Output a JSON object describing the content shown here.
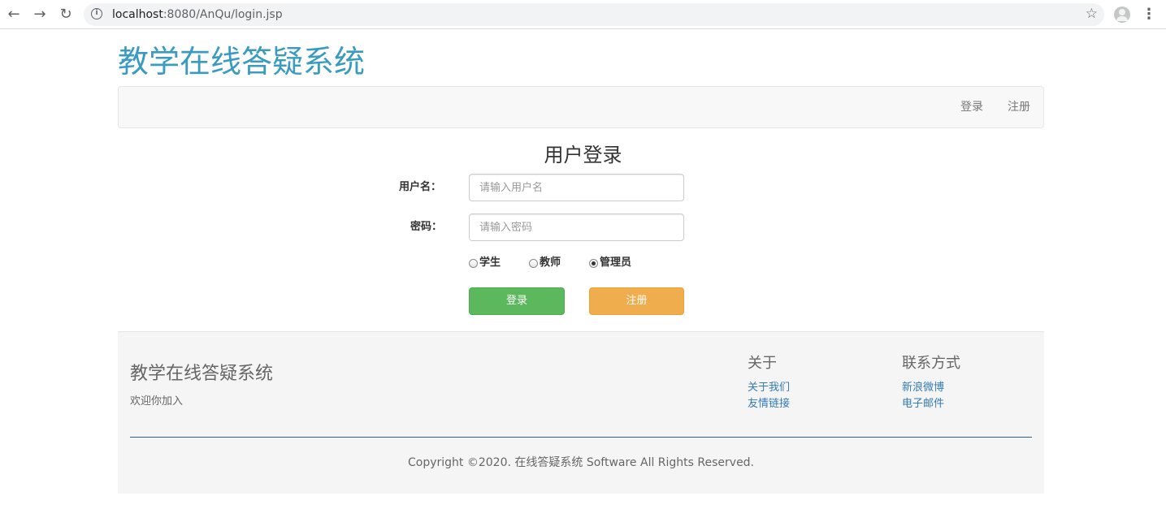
{
  "browser": {
    "url_host": "localhost",
    "url_rest": ":8080/AnQu/login.jsp",
    "icons": [
      "back-arrow-icon",
      "forward-arrow-icon",
      "reload-icon",
      "info-icon",
      "star-icon",
      "profile-avatar-icon",
      "more-menu-icon"
    ]
  },
  "header": {
    "site_title": "教学在线答疑系统"
  },
  "nav": {
    "login": "登录",
    "register": "注册"
  },
  "login_form": {
    "heading": "用户登录",
    "username_label": "用户名：",
    "username_placeholder": "请输入用户名",
    "password_label": "密码：",
    "password_placeholder": "请输入密码",
    "roles": [
      {
        "label": "学生",
        "checked": false
      },
      {
        "label": "教师",
        "checked": false
      },
      {
        "label": "管理员",
        "checked": true
      }
    ],
    "login_button": "登录",
    "register_button": "注册"
  },
  "footer": {
    "brand": "教学在线答疑系统",
    "tagline": "欢迎你加入",
    "about_title": "关于",
    "about_links": [
      "关于我们",
      "友情链接"
    ],
    "contact_title": "联系方式",
    "contact_links": [
      "新浪微博",
      "电子邮件"
    ],
    "copyright": "Copyright ©2020. 在线答疑系统 Software All Rights Reserved."
  },
  "colors": {
    "title": "#3a9bc0",
    "login_button": "#5cb85c",
    "register_button": "#f0ad4e",
    "link": "#337ab7"
  }
}
